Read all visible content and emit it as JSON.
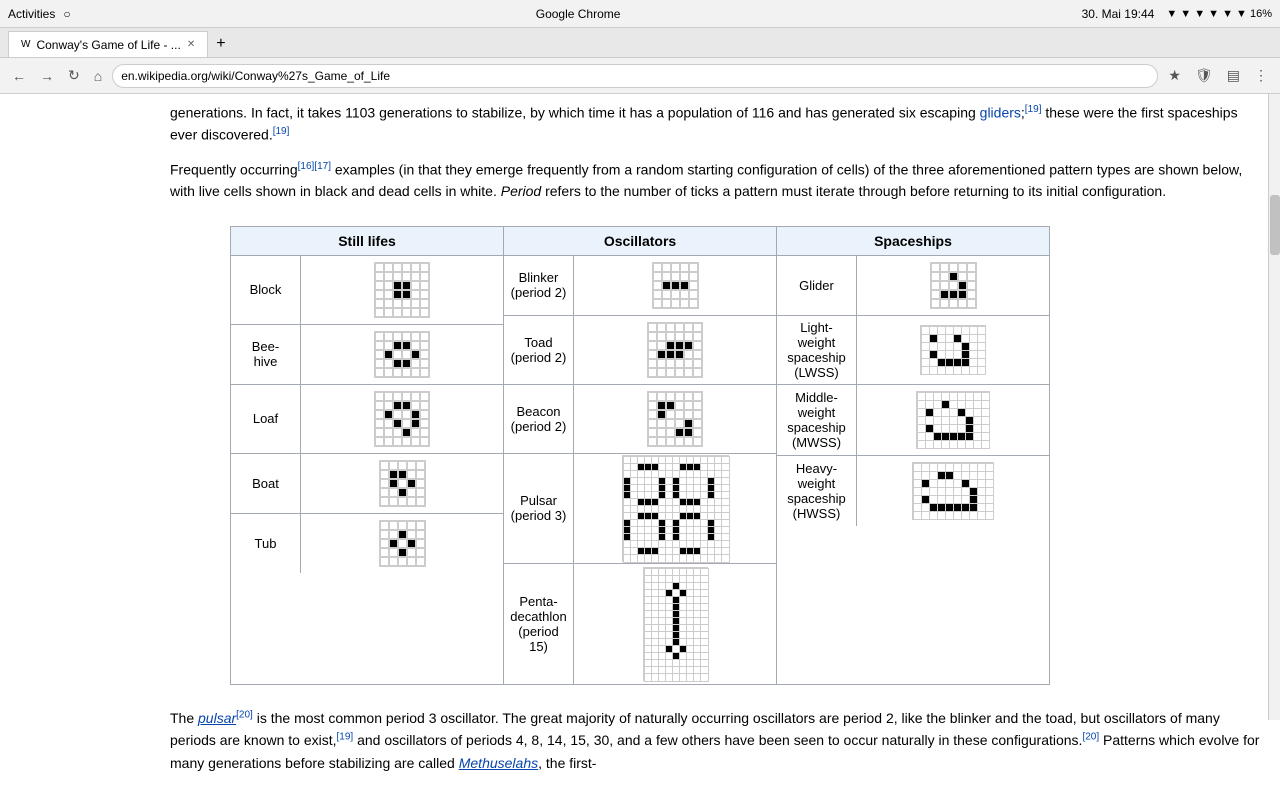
{
  "browser": {
    "titlebar_left": "Activities",
    "titlebar_center": "Google Chrome",
    "titlebar_time": "30. Mai  19:44",
    "tab_title": "Conway's Game of Life - ...",
    "url": "en.wikipedia.org/wiki/Conway%27s_Game_of_Life",
    "new_tab_label": "+"
  },
  "article": {
    "paragraph1": "generations. In fact, it takes 1103 generations to stabilize, by which time it has a population of 116 and has generated six escaping gliders; these were the first spaceships ever discovered.",
    "paragraph2": "Frequently occurring examples (in that they emerge frequently from a random starting configuration of cells) of the three aforementioned pattern types are shown below, with live cells shown in black and dead cells in white. Period refers to the number of ticks a pattern must iterate through before returning to its initial configuration.",
    "bottom1": "The pulsar is the most common period 3 oscillator. The great majority of naturally occurring oscillators are period 2, like the blinker and the toad, but oscillators of many periods are known to exist, and oscillators of periods 4, 8, 14, 15, 30, and a few others have been seen to occur naturally in these configurations. Patterns which evolve for many generations before stabilizing are called Methuselahs, the first-"
  },
  "table": {
    "sections": {
      "still_lifes": "Still lifes",
      "oscillators": "Oscillators",
      "spaceships": "Spaceships"
    },
    "patterns": {
      "still_lifes": [
        {
          "name": "Block"
        },
        {
          "name": "Bee-\nhive"
        },
        {
          "name": "Loaf"
        },
        {
          "name": "Boat"
        },
        {
          "name": "Tub"
        }
      ],
      "oscillators": [
        {
          "name": "Blinker\n(period 2)"
        },
        {
          "name": "Toad\n(period 2)"
        },
        {
          "name": "Beacon\n(period 2)"
        },
        {
          "name": "Pulsar\n(period 3)"
        },
        {
          "name": "Penta-\ndecathlon\n(period 15)"
        }
      ],
      "spaceships": [
        {
          "name": "Glider"
        },
        {
          "name": "Light-\nweight\nspaceship\n(LWSS)"
        },
        {
          "name": "Middle-\nweight\nspaceship\n(MWSS)"
        },
        {
          "name": "Heavy-\nweight\nspaceship\n(HWSS)"
        }
      ]
    }
  }
}
